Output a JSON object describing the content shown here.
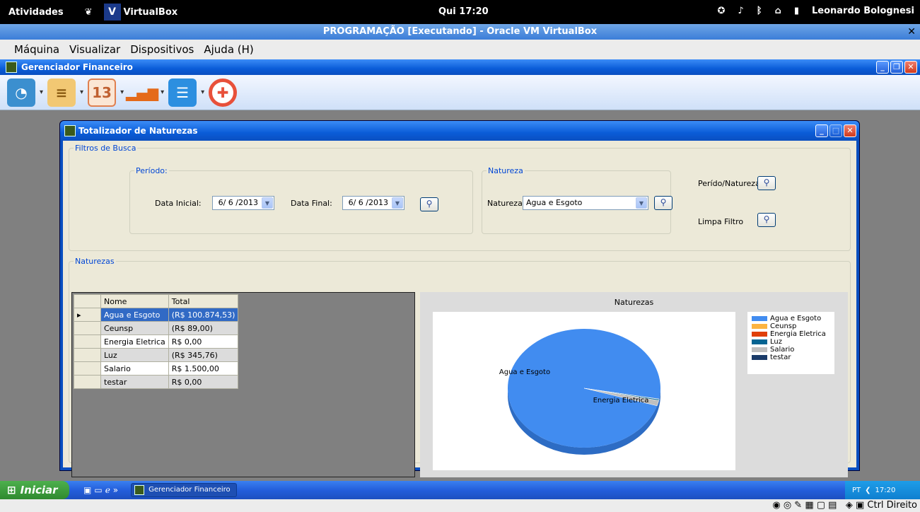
{
  "gnome": {
    "activities": "Atividades",
    "app_name": "VirtualBox",
    "clock": "Qui 17:20",
    "user": "Leonardo Bolognesi"
  },
  "vbox": {
    "title": "PROGRAMAÇÃO [Executando] - Oracle VM VirtualBox",
    "menu": [
      "Máquina",
      "Visualizar",
      "Dispositivos",
      "Ajuda (H)"
    ],
    "status_text": "Ctrl Direito"
  },
  "app": {
    "title": "Gerenciador Financeiro"
  },
  "child": {
    "title": "Totalizador de Naturezas",
    "filters_legend": "Filtros de Busca",
    "periodo_legend": "Período:",
    "data_inicial_label": "Data Inicial:",
    "data_inicial_value": "6/ 6 /2013",
    "data_final_label": "Data Final:",
    "data_final_value": "6/ 6 /2013",
    "natureza_legend": "Natureza",
    "natureza_label": "Natureza",
    "natureza_value": "Agua e Esgoto",
    "periodo_natureza_label": "Perído/Natureza",
    "limpa_filtro_label": "Limpa Filtro",
    "naturezas_legend": "Naturezas"
  },
  "grid": {
    "headers": [
      "Nome",
      "Total"
    ],
    "rows": [
      {
        "nome": "Agua e Esgoto",
        "total": "(R$ 100.874,53)"
      },
      {
        "nome": "Ceunsp",
        "total": "(R$ 89,00)"
      },
      {
        "nome": "Energia Eletrica",
        "total": "R$ 0,00"
      },
      {
        "nome": "Luz",
        "total": "(R$ 345,76)"
      },
      {
        "nome": "Salario",
        "total": "R$ 1.500,00"
      },
      {
        "nome": "testar",
        "total": "R$ 0,00"
      }
    ]
  },
  "chart_data": {
    "type": "pie",
    "title": "Naturezas",
    "categories": [
      "Agua e Esgoto",
      "Ceunsp",
      "Energia Eletrica",
      "Luz",
      "Salario",
      "testar"
    ],
    "values": [
      100874.53,
      89.0,
      0.0,
      345.76,
      1500.0,
      0.0
    ],
    "colors": [
      "#418cf0",
      "#fcb441",
      "#e0400a",
      "#056492",
      "#bfbfbf",
      "#1a3b69"
    ],
    "legend": "right",
    "slice_labels": [
      "Agua e Esgoto",
      "Energia Eletrica"
    ]
  },
  "taskbar": {
    "start": "Iniciar",
    "task": "Gerenciador Financeiro",
    "lang": "PT",
    "clock": "17:20"
  }
}
